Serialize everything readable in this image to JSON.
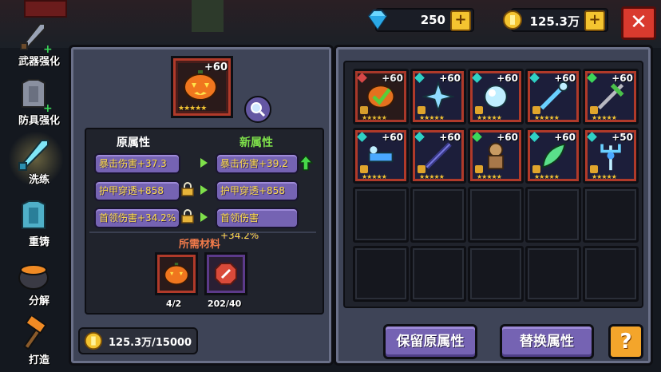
{
  "sidebar": {
    "items": [
      {
        "label": "武器强化",
        "icon": "sword-upgrade-icon",
        "active": false
      },
      {
        "label": "防具强化",
        "icon": "armor-upgrade-icon",
        "active": false
      },
      {
        "label": "洗练",
        "icon": "refine-sword-icon",
        "active": true
      },
      {
        "label": "重铸",
        "icon": "reforge-armor-icon",
        "active": false
      },
      {
        "label": "分解",
        "icon": "cauldron-icon",
        "active": false
      },
      {
        "label": "打造",
        "icon": "hammer-icon",
        "active": false
      }
    ]
  },
  "topbar": {
    "gems": "250",
    "coins": "125.3万",
    "gem_plus": "+",
    "coin_plus": "+",
    "close": "✕"
  },
  "refine": {
    "item_level": "+60",
    "old_title": "原属性",
    "new_title": "新属性",
    "old_stats": [
      "暴击伤害+37.3",
      "护甲穿透+858",
      "首领伤害+34.2%"
    ],
    "new_stats": [
      "暴击伤害+39.2",
      "护甲穿透+858",
      "首领伤害+34.2%"
    ],
    "locked": [
      false,
      true,
      true
    ],
    "improved": [
      true,
      false,
      false
    ],
    "materials_title": "所需材料",
    "materials": [
      {
        "icon": "pumpkin-icon",
        "count": "4/2",
        "rarity": "red"
      },
      {
        "icon": "refine-stone-icon",
        "count": "202/40",
        "rarity": "purple"
      }
    ],
    "cost": "125.3万/15000"
  },
  "inventory": {
    "items": [
      {
        "level": "+60",
        "icon": "pumpkin-selected-icon",
        "stars": 5,
        "gem": "#e04a4a",
        "selected": true
      },
      {
        "level": "+60",
        "icon": "ice-shuriken-icon",
        "stars": 5,
        "gem": "#2fd1c5"
      },
      {
        "level": "+60",
        "icon": "ice-orb-icon",
        "stars": 5,
        "gem": "#2fd1c5"
      },
      {
        "level": "+60",
        "icon": "ice-staff-icon",
        "stars": 5,
        "gem": "#2fd1c5"
      },
      {
        "level": "+60",
        "icon": "green-crossbow-icon",
        "stars": 5,
        "gem": "#3cd65a"
      },
      {
        "level": "+60",
        "icon": "ice-gun-icon",
        "stars": 5,
        "gem": "#2fd1c5"
      },
      {
        "level": "+60",
        "icon": "dark-blade-icon",
        "stars": 5,
        "gem": "#2fd1c5"
      },
      {
        "level": "+60",
        "icon": "scarecrow-icon",
        "stars": 5,
        "gem": "#3cd65a"
      },
      {
        "level": "+60",
        "icon": "leaf-blade-icon",
        "stars": 5,
        "gem": "#2fd1c5"
      },
      {
        "level": "+50",
        "icon": "ice-trident-icon",
        "stars": 5,
        "gem": "#2fd1c5"
      }
    ],
    "empty_slots": 10
  },
  "buttons": {
    "keep": "保留原属性",
    "replace": "替换属性",
    "help": "?"
  }
}
